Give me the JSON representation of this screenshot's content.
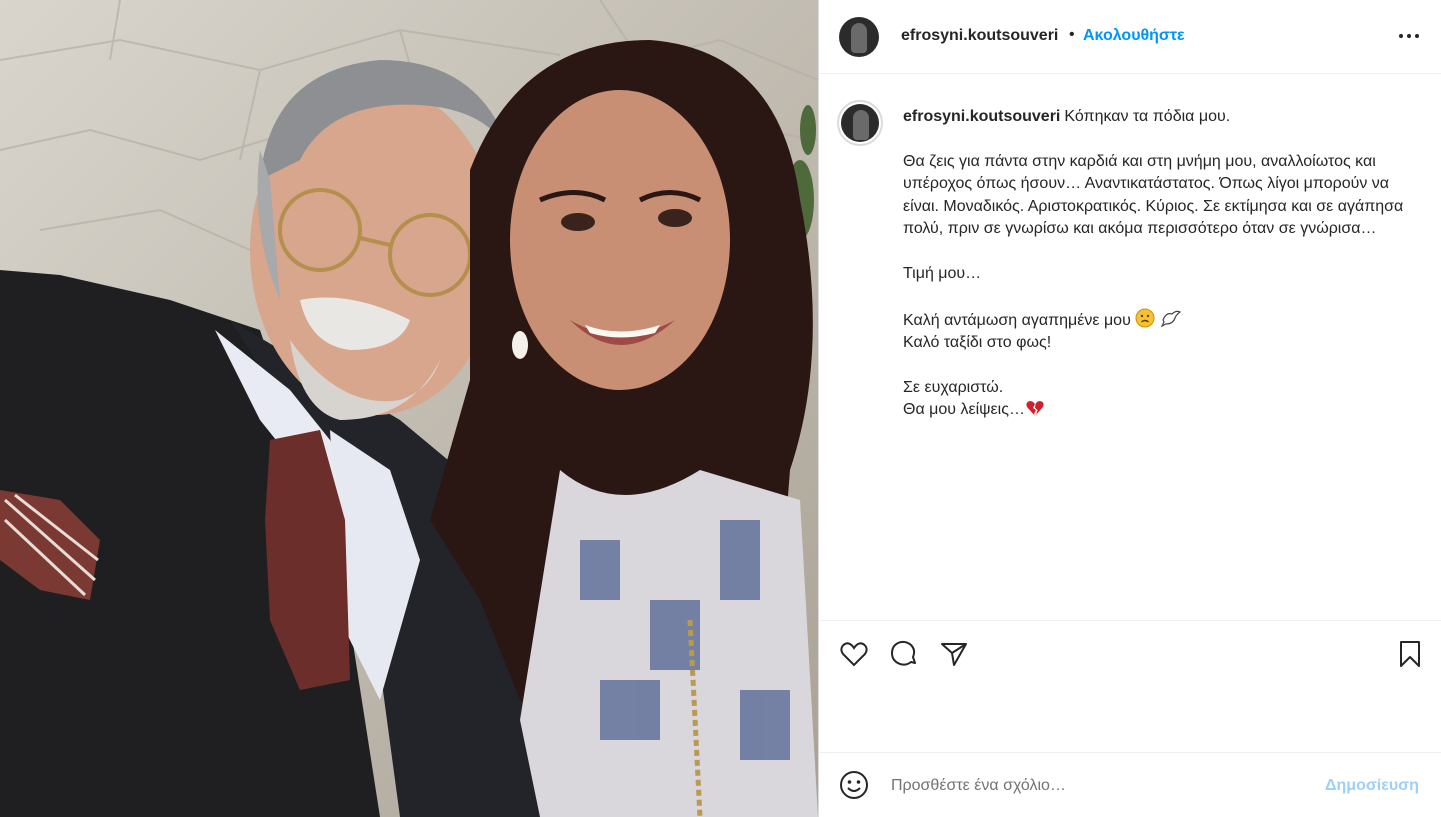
{
  "photo": {
    "alt": ""
  },
  "header": {
    "username": "efrosyni.koutsouveri",
    "separator": "•",
    "follow_label": "Ακολουθήστε",
    "more_icon": "more-horizontal-icon"
  },
  "caption": {
    "username": "efrosyni.koutsouveri",
    "first_line": "Κόπηκαν τα πόδια μου.",
    "paragraph1": "Θα ζεις για πάντα στην καρδιά και στη μνήμη μου, αναλλοίωτος και υπέροχος όπως ήσουν… Αναντικατάστατος. Όπως λίγοι μπορούν να είναι. Μοναδικός. Αριστοκρατικός. Κύριος. Σε εκτίμησα και σε αγάπησα πολύ, πριν σε γνωρίσω και ακόμα περισσότερο όταν σε γνώρισα…",
    "line_honor": "Τιμή μου…",
    "line_goodbye": "Καλή αντάμωση αγαπημένε μου",
    "line_journey": "Καλό ταξίδι στο φως!",
    "line_thanks": "Σε ευχαριστώ.",
    "line_miss": "Θα μου λείψεις…"
  },
  "actions": {
    "like_icon": "heart-icon",
    "comment_icon": "comment-icon",
    "share_icon": "paper-plane-icon",
    "save_icon": "bookmark-icon"
  },
  "comment": {
    "placeholder": "Προσθέστε ένα σχόλιο…",
    "post_label": "Δημοσίευση",
    "emoji_icon": "smiley-icon"
  },
  "colors": {
    "link": "#0095f6",
    "post_disabled": "#9fcff7",
    "text": "#262626",
    "muted": "#737373"
  }
}
